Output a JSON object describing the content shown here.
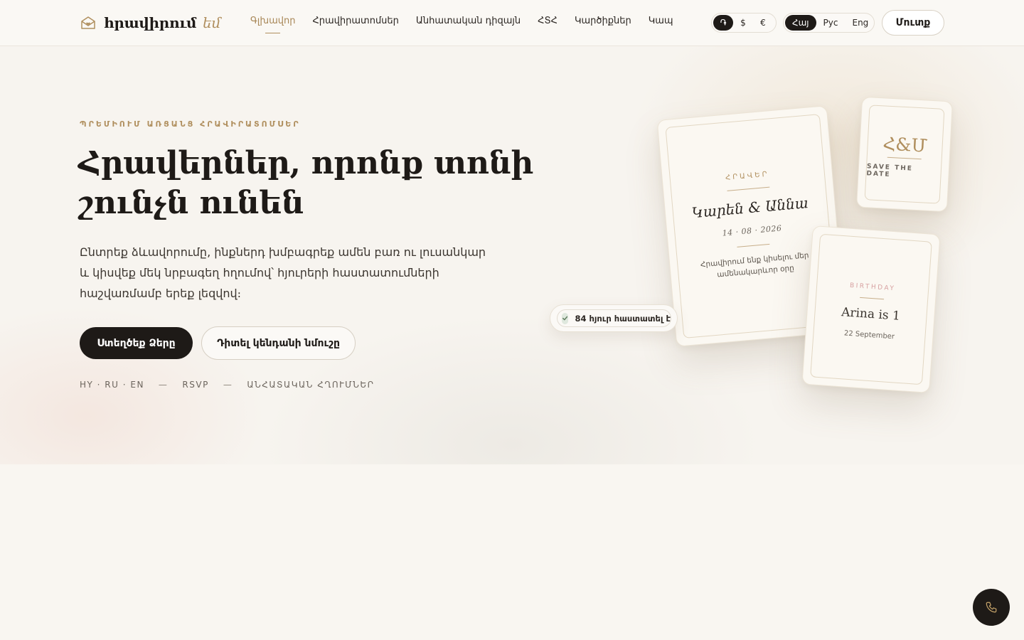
{
  "brand": {
    "name": "հրավիրում",
    "accent": "եմ"
  },
  "nav": {
    "items": [
      {
        "label": "Գլխավոր",
        "active": true
      },
      {
        "label": "Հրավիրատոմսեր"
      },
      {
        "label": "Անհատական դիզայն"
      },
      {
        "label": "ՀՏՀ"
      },
      {
        "label": "Կարծիքներ"
      },
      {
        "label": "Կապ"
      }
    ]
  },
  "currency": {
    "options": [
      "֏",
      "$",
      "€"
    ],
    "selected": "֏"
  },
  "language": {
    "options": [
      "Հայ",
      "Рус",
      "Eng"
    ],
    "selected": "Հայ"
  },
  "login_label": "Մուտք",
  "hero": {
    "eyebrow": "ՊՐԵՄԻՈՒՄ ԱՌՑԱՆՑ ՀՐԱՎԻՐԱՏՈՄՍԵՐ",
    "title": "Հրավերներ, որոնք տոնի շունչն ունեն",
    "subtitle": "Ընտրեք ձևավորումը, ինքներդ խմբագրեք ամեն բառ ու լուսանկար և կիսվեք մեկ նրբագեղ հղումով՝ հյուրերի հաստատումների հաշվառմամբ երեք լեզվով։",
    "cta_primary": "Ստեղծեք Ձերը",
    "cta_secondary": "Դիտել կենդանի նմուշը",
    "features": [
      "HY · RU · EN",
      "—",
      "RSVP",
      "—",
      "ԱՆՀԱՏԱԿԱՆ ՀՂՈՒՄՆԵՐ"
    ]
  },
  "cards": {
    "main": {
      "kicker": "ՀՐԱՎԵՐ",
      "names": "Կարեն & Աննա",
      "date": "14 · 08 · 2026",
      "text": "Հրավիրում ենք կիսելու մեր ամենակարևոր օրը"
    },
    "save_the_date": {
      "monogram": "Հ&Մ",
      "label": "SAVE THE DATE"
    },
    "birthday": {
      "kicker": "BIRTHDAY",
      "name": "Arina is 1",
      "date": "22 September"
    }
  },
  "toast": {
    "text": "84 հյուր հաստատել է"
  },
  "colors": {
    "accent": "#b08f5e",
    "dark": "#1e1a17",
    "background": "#f9f6f1",
    "blush": "#d7a1a1"
  },
  "icons": {
    "logo": "envelope-heart-icon",
    "check": "check-icon",
    "call": "phone-icon"
  }
}
